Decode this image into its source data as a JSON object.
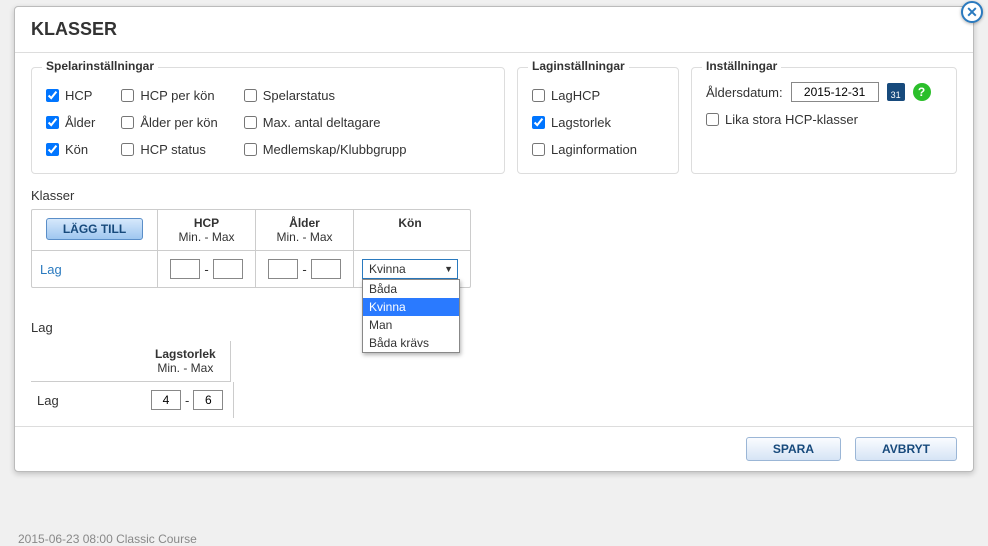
{
  "backdrop_text": "2015-06-23  08:00   Classic Course",
  "title": "KLASSER",
  "close_glyph": "✕",
  "player": {
    "title": "Spelarinställningar",
    "col1": [
      {
        "label": "HCP",
        "checked": true
      },
      {
        "label": "Ålder",
        "checked": true
      },
      {
        "label": "Kön",
        "checked": true
      }
    ],
    "col2": [
      {
        "label": "HCP per kön",
        "checked": false
      },
      {
        "label": "Ålder per kön",
        "checked": false
      },
      {
        "label": "HCP status",
        "checked": false
      }
    ],
    "col3": [
      {
        "label": "Spelarstatus",
        "checked": false
      },
      {
        "label": "Max. antal deltagare",
        "checked": false
      },
      {
        "label": "Medlemskap/Klubbgrupp",
        "checked": false
      }
    ]
  },
  "team": {
    "title": "Laginställningar",
    "items": [
      {
        "label": "LagHCP",
        "checked": false
      },
      {
        "label": "Lagstorlek",
        "checked": true
      },
      {
        "label": "Laginformation",
        "checked": false
      }
    ]
  },
  "settings": {
    "title": "Inställningar",
    "date_label": "Åldersdatum:",
    "date_value": "2015-12-31",
    "cal_text": "31",
    "help_text": "?",
    "equal_hcp": {
      "label": "Lika stora HCP-klasser",
      "checked": false
    }
  },
  "klasser": {
    "label": "Klasser",
    "add_label": "LÄGG TILL",
    "hdr_hcp": "HCP",
    "hdr_alder": "Ålder",
    "hdr_kon": "Kön",
    "hdr_minmax": "Min. - Max",
    "row_label": "Lag",
    "hcp_min": "",
    "hcp_max": "",
    "alder_min": "",
    "alder_max": "",
    "kon_selected": "Kvinna",
    "kon_options": [
      "Båda",
      "Kvinna",
      "Man",
      "Båda krävs"
    ]
  },
  "lag": {
    "label": "Lag",
    "hdr_size": "Lagstorlek",
    "hdr_minmax": "Min. - Max",
    "row_label": "Lag",
    "min": "4",
    "max": "6"
  },
  "footer": {
    "save": "SPARA",
    "cancel": "AVBRYT"
  }
}
